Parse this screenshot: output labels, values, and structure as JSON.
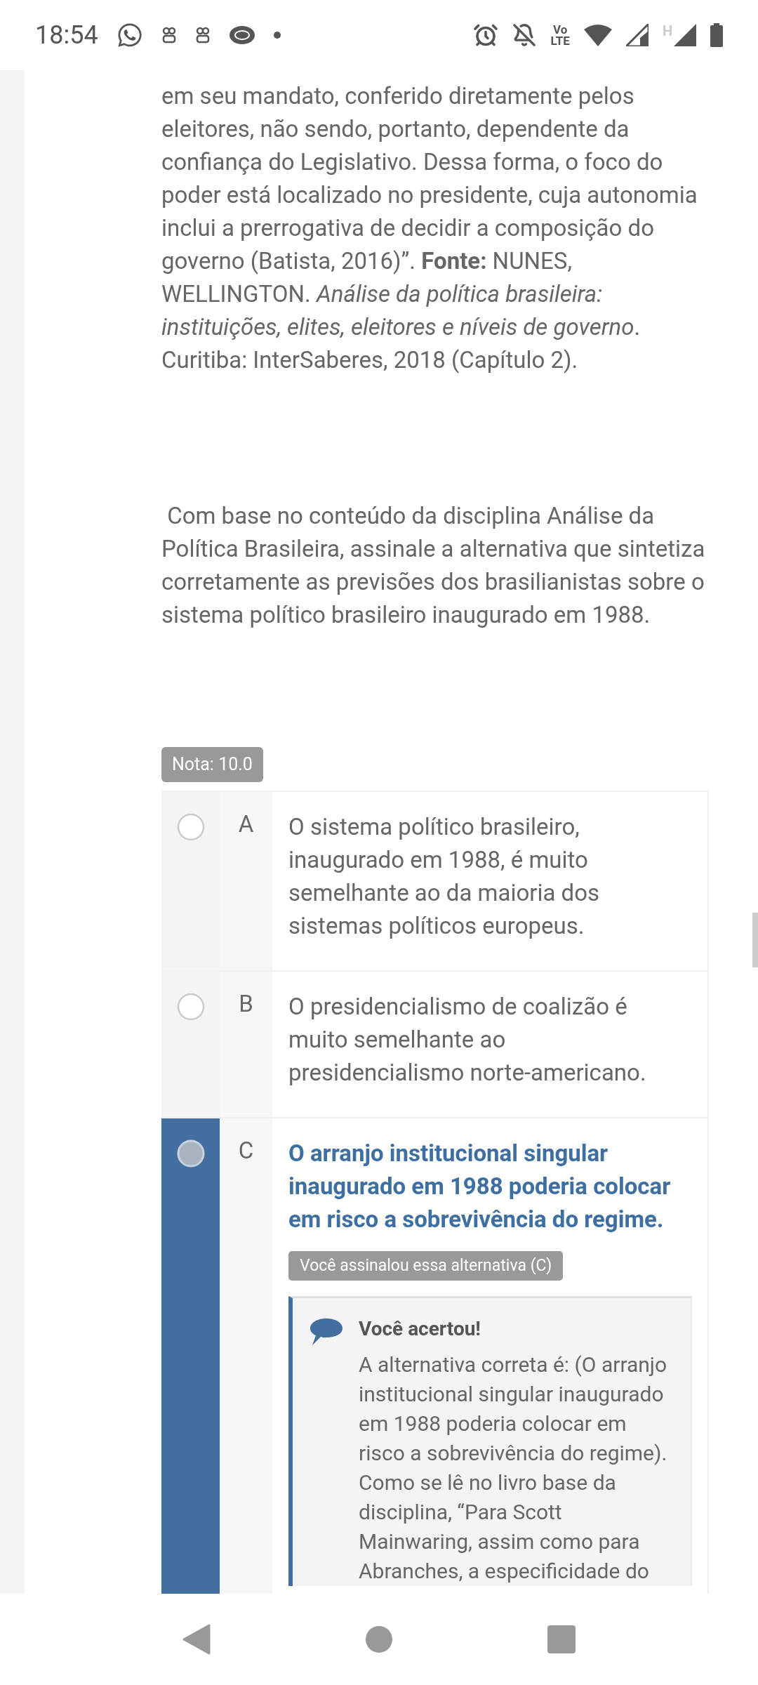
{
  "status_bar": {
    "time": "18:54",
    "volte_top": "Vo",
    "volte_bottom": "LTE",
    "data_type": "H"
  },
  "passage": "em seu mandato, conferido diretamente pelos eleitores, não sendo, portanto, dependente da confiança do Legislativo. Dessa forma, o foco do poder está localizado no presidente, cuja autonomia inclui a prerrogativa de decidir a composição do governo (Batista, 2016)”. **Fonte:** NUNES, WELLINGTON. *Análise da política brasileira: instituições, elites, eleitores e níveis de governo*. Curitiba: InterSaberes, 2018 (Capítulo 2).",
  "question": " Com base no conteúdo da disciplina Análise da Política Brasileira, assinale a alternativa que sintetiza corretamente as previsões dos brasilianistas sobre o sistema político brasileiro inaugurado em 1988.",
  "grade_badge": "Nota: 10.0",
  "options": [
    {
      "letter": "A",
      "text": "O sistema político brasileiro, inaugurado em 1988, é muito semelhante ao da maioria dos sistemas políticos europeus.",
      "selected": false
    },
    {
      "letter": "B",
      "text": "O presidencialismo de coalizão é muito semelhante ao presidencialismo norte-americano.",
      "selected": false
    },
    {
      "letter": "C",
      "text": "O arranjo institucional singular inaugurado em 1988 poderia colocar em risco a sobrevivência do regime.",
      "selected": true,
      "note": "Você assinalou essa alternativa (C)",
      "feedback": {
        "title": "Você acertou!",
        "text": "A alternativa correta é: (O arranjo institucional singular inaugurado em 1988 poderia colocar em risco a sobrevivência do regime). Como se lê no livro base da disciplina, “Para Scott Mainwaring, assim como para Abranches, a especificidade do"
      }
    }
  ]
}
